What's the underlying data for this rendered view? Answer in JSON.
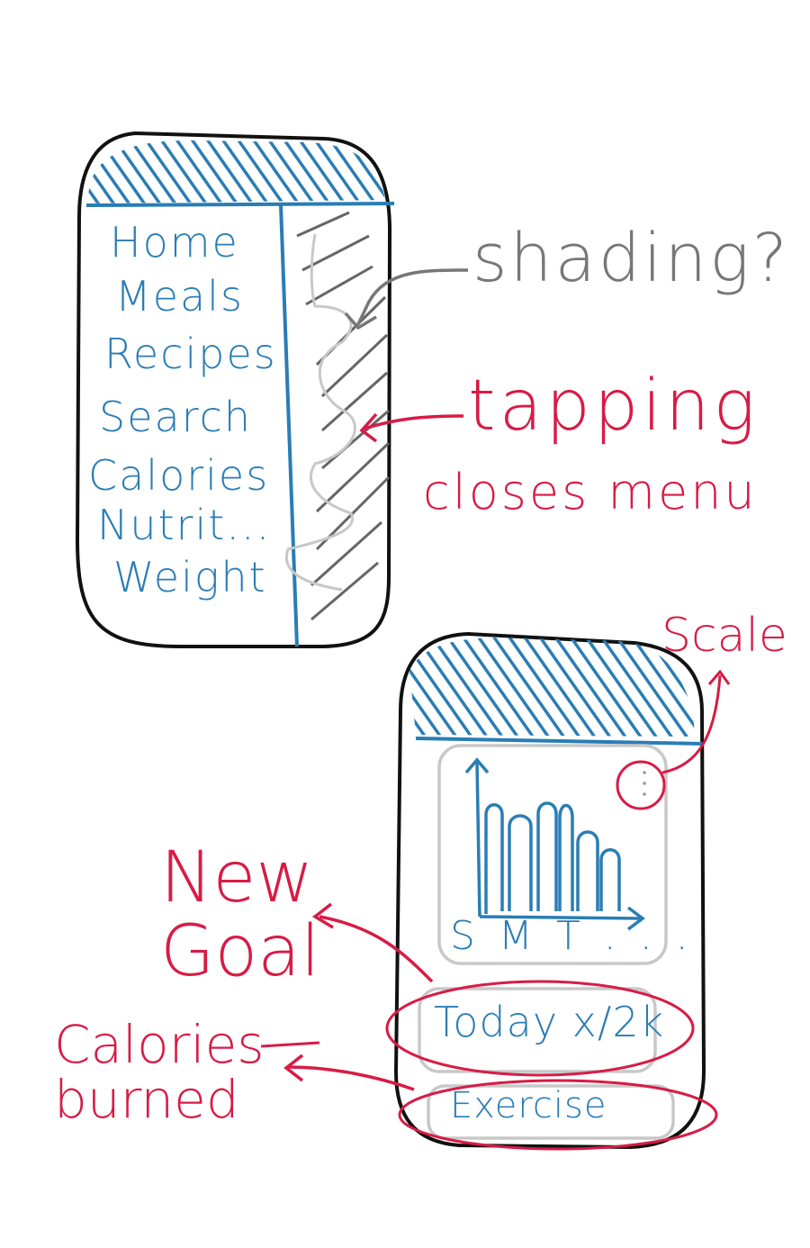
{
  "menu_screen": {
    "menu_items": [
      "Home",
      "Meals",
      "Recipes",
      "Search",
      "Calories",
      "Nutrit...",
      "Weight"
    ],
    "annotations": {
      "shading": "shading?",
      "tapping": "tapping",
      "closes_menu": "closes menu"
    }
  },
  "dashboard_screen": {
    "chart_axis_label": "S M T . . .",
    "today_card": "Today x/2k",
    "exercise_card": "Exercise",
    "annotations": {
      "scale": "Scale",
      "new_goal": "New Goal",
      "calories_burned": "Calories burned"
    }
  },
  "colors": {
    "ui_blue": "#2a7db5",
    "annotation_red": "#d81b45",
    "annotation_gray": "#777777",
    "outline": "#111111",
    "card_gray": "#c8c8c8"
  }
}
